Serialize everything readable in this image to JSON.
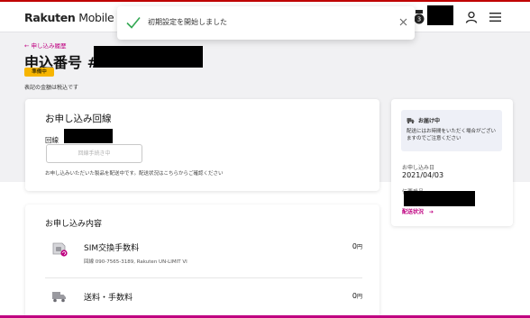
{
  "header": {
    "logo_brand": "Rakuten",
    "logo_product": " Mobile"
  },
  "toast": {
    "message": "初期設定を開始しました"
  },
  "page": {
    "back_link": "← 申し込み履歴",
    "title": "申込番号 #",
    "status": "準備中",
    "tax_note": "表記の金額は税込です"
  },
  "line_card": {
    "title": "お申し込み回線",
    "line_label": "回線",
    "switch_button": "回線手続き中",
    "note": "お申し込みいただいた製品を配送中です。配送状況はこちらからご確認ください"
  },
  "contents_card": {
    "title": "お申し込み内容",
    "items": [
      {
        "name": "SIM交換手数料",
        "sub": "回線 090-7565-3189, Rakuten UN-LIMIT VI",
        "price": "0",
        "unit": "円"
      },
      {
        "name": "送料・手数料",
        "sub": "",
        "price": "0",
        "unit": "円"
      }
    ]
  },
  "side_card": {
    "notice_title": "お届け中",
    "notice_body": "配送にはお時間をいただく場合がございますのでご注意ください",
    "date_label": "お申し込み日",
    "date_value": "2021/04/03",
    "track_label": "伝票番号",
    "status_link": "配送状況",
    "status_arrow": "➔"
  },
  "colors": {
    "brand": "#bf0000",
    "link": "#bf0080",
    "status_badge": "#f7b500",
    "check": "#34a853"
  },
  "icons": [
    "badge-icon",
    "user-icon",
    "menu-icon",
    "check-icon",
    "close-icon",
    "sim-icon",
    "truck-icon"
  ]
}
